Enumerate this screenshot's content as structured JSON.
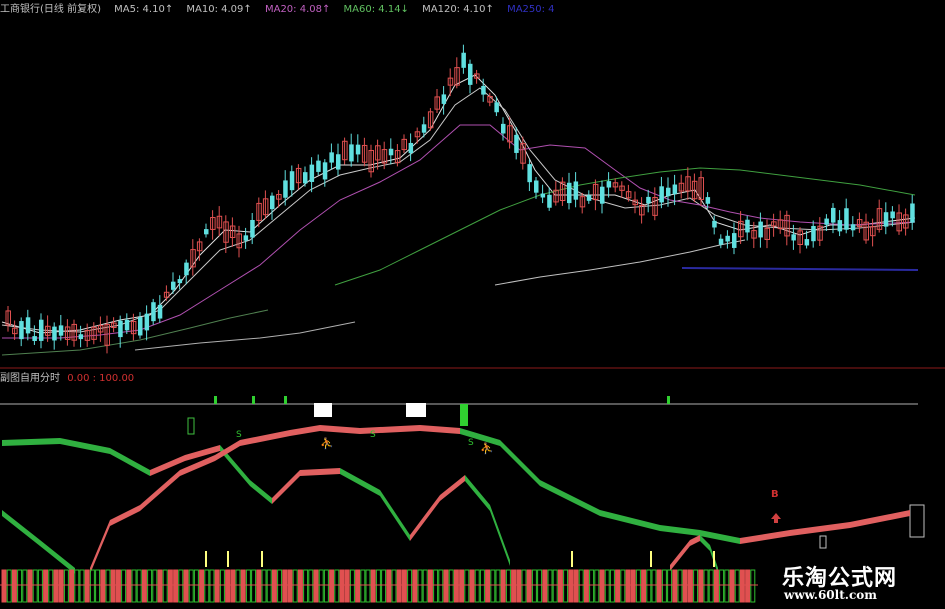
{
  "main_legend": {
    "title": "工商银行(日线 前复权)",
    "ma5": "MA5: 4.10↑",
    "ma10": "MA10: 4.09↑",
    "ma20": "MA20: 4.08↑",
    "ma60": "MA60: 4.14↓",
    "ma120": "MA120: 4.10↑",
    "ma250": "MA250: 4",
    "colors": {
      "title": "#c0c0c0",
      "ma5": "#c0c0c0",
      "ma10": "#c0c0c0",
      "ma20": "#c060c0",
      "ma60": "#60c060",
      "ma120": "#c0c0c0",
      "ma250": "#3030c0"
    }
  },
  "sub_legend": {
    "title": "副图自用分时",
    "value": "0.00 : 100.00",
    "colors": {
      "title": "#c0c0c0",
      "value": "#d03030"
    }
  },
  "markers": {
    "sell": "S",
    "buy": "B"
  },
  "brand": {
    "name": "乐淘公式网",
    "url": "www.60lt.com"
  }
}
